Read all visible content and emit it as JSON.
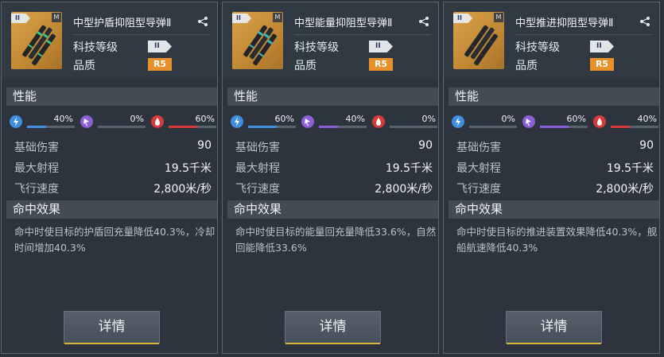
{
  "cards": [
    {
      "name": "中型护盾抑阻型导弹Ⅱ",
      "tier_tag": "II",
      "m_tag": "M",
      "tech_label": "科技等级",
      "tech_level": "II",
      "quality_label": "品质",
      "quality": "R5",
      "section_perf": "性能",
      "resists": [
        {
          "type": "electric",
          "value": "40%",
          "level": 0.4,
          "color": "#3f8ee0"
        },
        {
          "type": "psionic",
          "value": "0%",
          "level": 0.0,
          "color": "#8b5fd8"
        },
        {
          "type": "fire",
          "value": "60%",
          "level": 0.6,
          "color": "#d63a3a"
        }
      ],
      "stats": [
        {
          "label": "基础伤害",
          "value": "90"
        },
        {
          "label": "最大射程",
          "value": "19.5千米"
        },
        {
          "label": "飞行速度",
          "value": "2,800米/秒"
        }
      ],
      "section_hit": "命中效果",
      "effect": "命中时使目标的护盾回充量降低40.3%，冷却时间增加40.3%",
      "button": "详情",
      "stripe_color": "#2cc88a"
    },
    {
      "name": "中型能量抑阻型导弹Ⅱ",
      "tier_tag": "II",
      "m_tag": "M",
      "tech_label": "科技等级",
      "tech_level": "II",
      "quality_label": "品质",
      "quality": "R5",
      "section_perf": "性能",
      "resists": [
        {
          "type": "electric",
          "value": "60%",
          "level": 0.6,
          "color": "#3f8ee0"
        },
        {
          "type": "psionic",
          "value": "40%",
          "level": 0.4,
          "color": "#8b5fd8"
        },
        {
          "type": "fire",
          "value": "0%",
          "level": 0.0,
          "color": "#d63a3a"
        }
      ],
      "stats": [
        {
          "label": "基础伤害",
          "value": "90"
        },
        {
          "label": "最大射程",
          "value": "19.5千米"
        },
        {
          "label": "飞行速度",
          "value": "2,800米/秒"
        }
      ],
      "section_hit": "命中效果",
      "effect": "命中时使目标的能量回充量降低33.6%，自然回能降低33.6%",
      "button": "详情",
      "stripe_color": "#2ac0d0"
    },
    {
      "name": "中型推进抑阻型导弹Ⅱ",
      "tier_tag": "II",
      "m_tag": "M",
      "tech_label": "科技等级",
      "tech_level": "II",
      "quality_label": "品质",
      "quality": "R5",
      "section_perf": "性能",
      "resists": [
        {
          "type": "electric",
          "value": "0%",
          "level": 0.0,
          "color": "#3f8ee0"
        },
        {
          "type": "psionic",
          "value": "60%",
          "level": 0.6,
          "color": "#8b5fd8"
        },
        {
          "type": "fire",
          "value": "40%",
          "level": 0.4,
          "color": "#d63a3a"
        }
      ],
      "stats": [
        {
          "label": "基础伤害",
          "value": "90"
        },
        {
          "label": "最大射程",
          "value": "19.5千米"
        },
        {
          "label": "飞行速度",
          "value": "2,800米/秒"
        }
      ],
      "section_hit": "命中效果",
      "effect": "命中时使目标的推进装置效果降低40.3%，舰船航速降低40.3%",
      "button": "详情",
      "stripe_color": "#2c2f33"
    }
  ]
}
